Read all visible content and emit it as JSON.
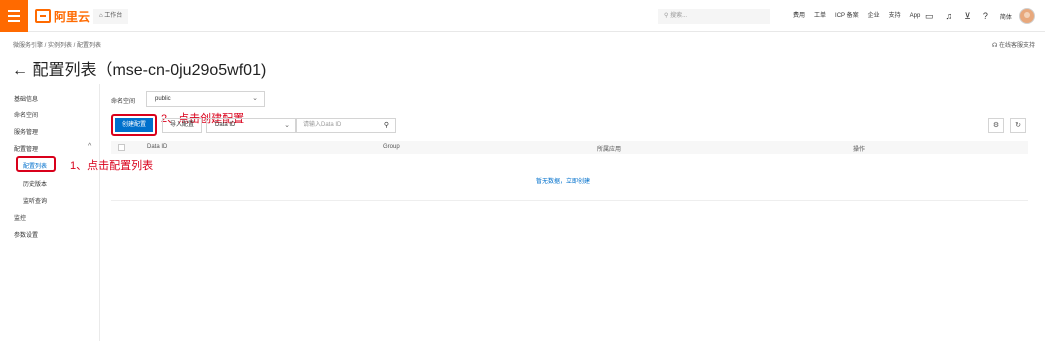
{
  "topbar": {
    "brand": "阿里云",
    "workbench": "工作台",
    "search_placeholder": "搜索...",
    "links": [
      "费用",
      "工单",
      "ICP 备案",
      "企业",
      "支持",
      "App"
    ],
    "lang_label": "简体"
  },
  "breadcrumb": "微服务引擎 / 实例列表 / 配置列表",
  "support_label": "在线客服支持",
  "page": {
    "title": "← 配置列表（mse-cn-0ju29o5wf01)"
  },
  "sidebar": {
    "items": [
      "基础信息",
      "命名空间",
      "服务管理",
      "配置管理"
    ],
    "config_children": [
      "配置列表",
      "历史版本",
      "监听查询"
    ],
    "bottom_items": [
      "监控",
      "参数设置"
    ]
  },
  "annotations": {
    "step1": "1、点击配置列表",
    "step2": "2、点击创建配置"
  },
  "toolbar": {
    "namespace_label": "命名空间",
    "namespace_value": "public",
    "create_button": "创建配置",
    "import_button": "导入配置",
    "filter_value": "Data ID",
    "search_placeholder": "请输入Data ID"
  },
  "table": {
    "columns": [
      "Data ID",
      "Group",
      "所属应用",
      "操作"
    ],
    "empty_text": "暂无数据，立即创建"
  },
  "icons": [
    "menu-icon",
    "home-icon",
    "search-icon",
    "bell-icon",
    "cart-icon",
    "help-icon",
    "headset-icon",
    "settings-icon",
    "refresh-icon"
  ]
}
